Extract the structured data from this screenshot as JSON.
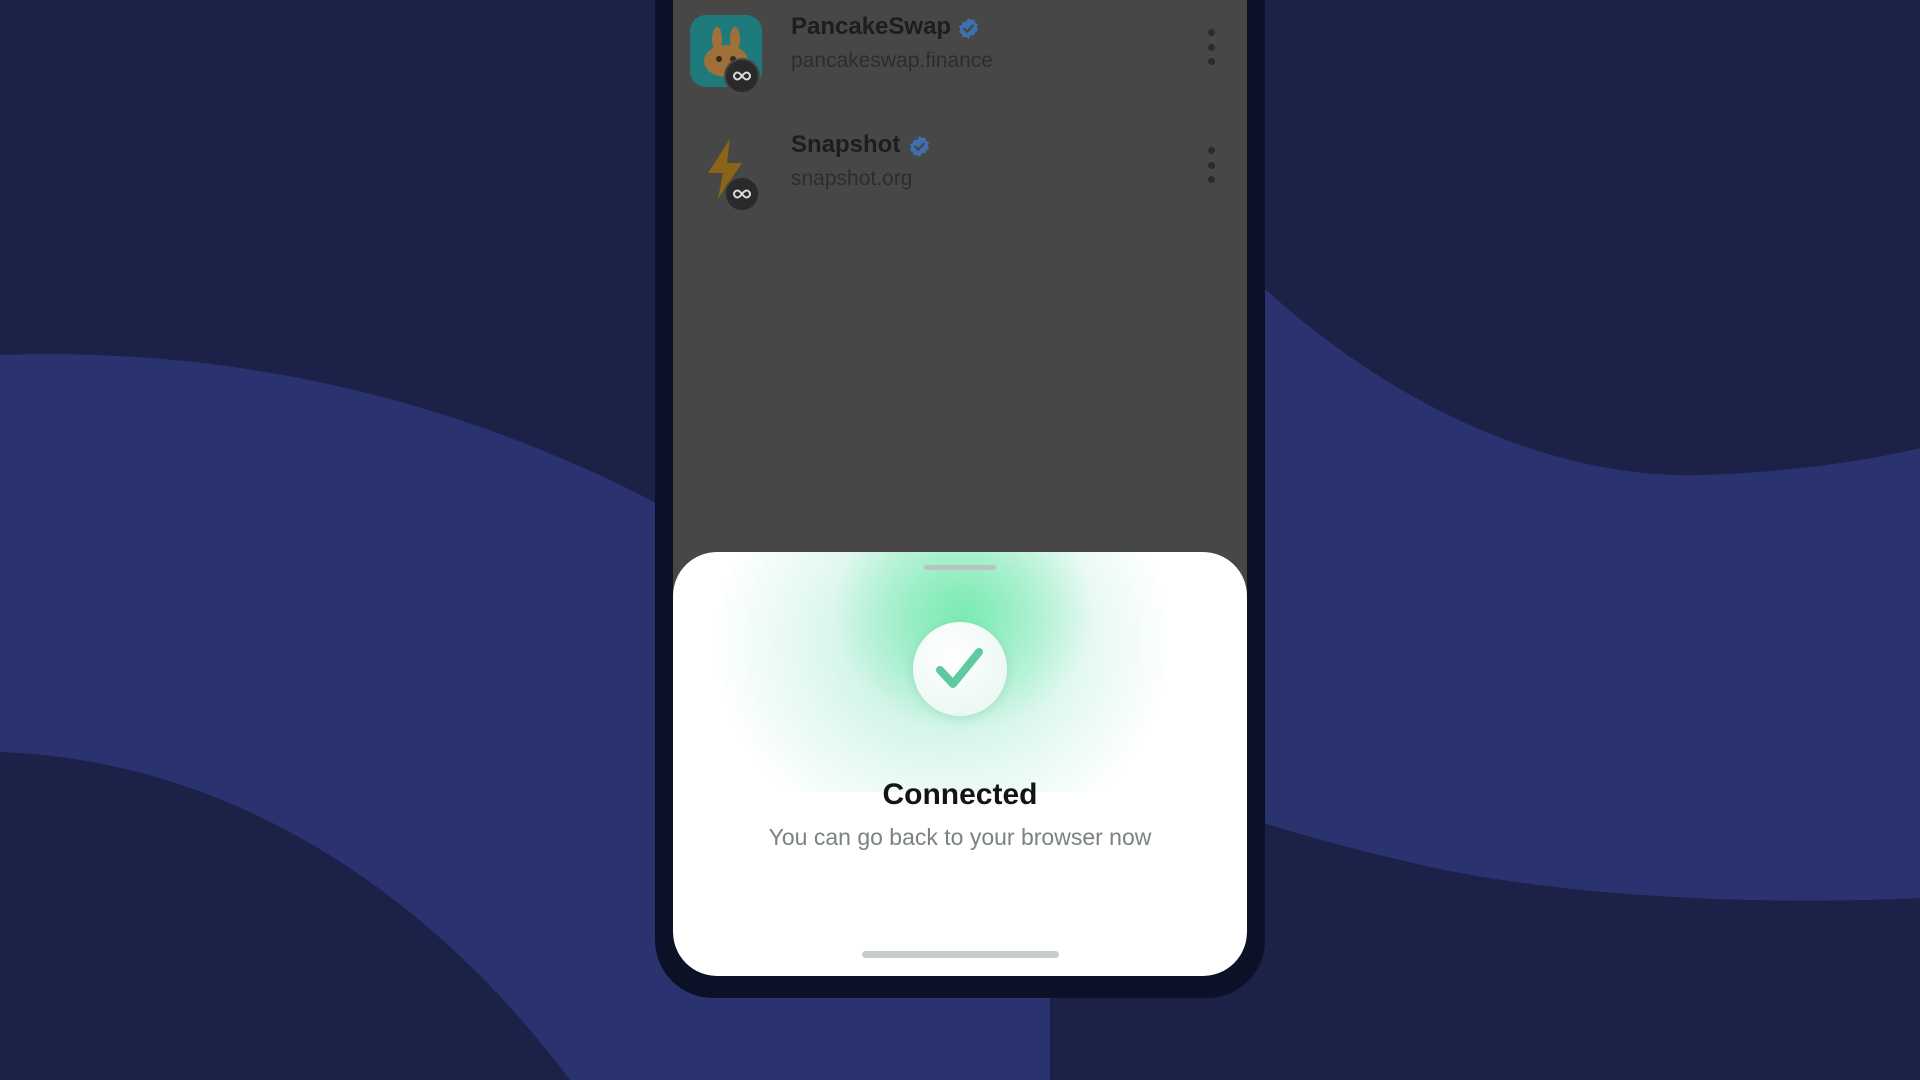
{
  "dapps": [
    {
      "name": "PancakeSwap",
      "url": "pancakeswap.finance",
      "icon": "pancakeswap-logo-icon",
      "verified": true
    },
    {
      "name": "Snapshot",
      "url": "snapshot.org",
      "icon": "lightning-bolt-icon",
      "verified": true
    }
  ],
  "sheet": {
    "title": "Connected",
    "subtitle": "You can go back to your browser now",
    "status_icon": "checkmark-icon"
  },
  "colors": {
    "background": "#1b2147",
    "wave": "#2a3270",
    "phone_frame": "#0c1128",
    "overlay": "#474747",
    "success_green": "#5fc9a0",
    "verified_blue": "#3b82f6"
  }
}
